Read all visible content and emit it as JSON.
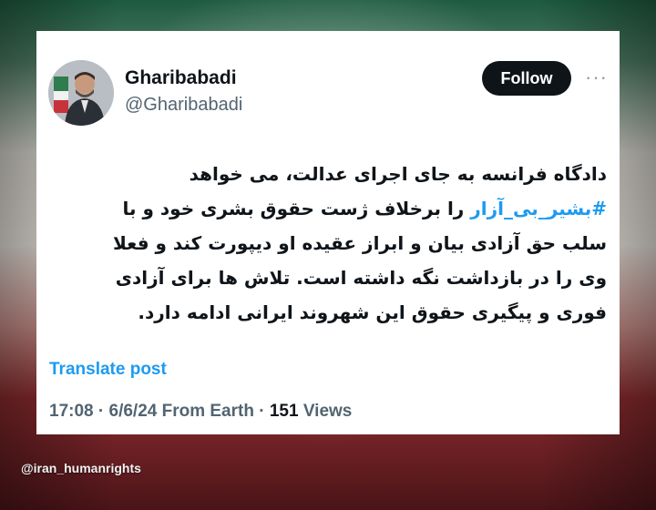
{
  "tweet": {
    "author_name": "Gharibabadi",
    "author_handle": "@Gharibabadi",
    "follow_label": "Follow",
    "more_label": "···",
    "text_lines": [
      {
        "before": "دادگاه فرانسه به جای اجرای عدالت، می خواهد",
        "hashtag": "",
        "after": ""
      },
      {
        "before": "",
        "hashtag": "#بشیر_بی_آزار",
        "after": " را برخلاف ژست حقوق بشری خود و با"
      },
      {
        "before": "سلب حق آزادی بیان و ابراز عقیده او دیپورت کند و فعلا",
        "hashtag": "",
        "after": ""
      },
      {
        "before": "وی را در بازداشت نگه داشته است. تلاش ها برای آزادی",
        "hashtag": "",
        "after": ""
      },
      {
        "before": "فوری و پیگیری حقوق این شهروند ایرانی ادامه دارد.",
        "hashtag": "",
        "after": ""
      }
    ],
    "translate_label": "Translate post",
    "time": "17:08",
    "date": "6/6/24",
    "source": "From Earth",
    "separator": "·",
    "views_count": "151",
    "views_label": "Views"
  },
  "watermark": "@iran_humanrights",
  "colors": {
    "link": "#1d9bf0",
    "text": "#0f1419",
    "muted": "#536471",
    "follow_bg": "#0f1419"
  }
}
